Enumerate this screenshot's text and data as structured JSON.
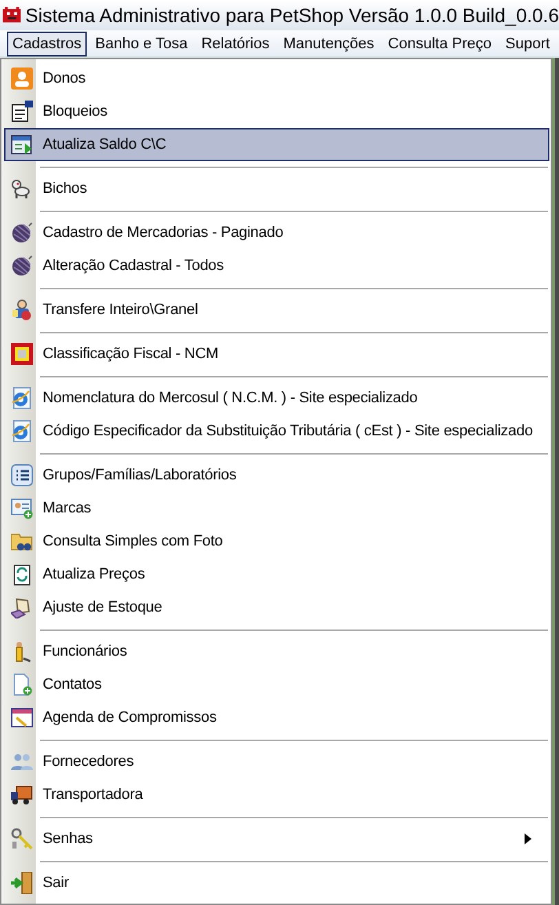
{
  "window": {
    "title": "Sistema Administrativo para PetShop Versão 1.0.0 Build_0.0.6"
  },
  "menubar": [
    {
      "label": "Cadastros",
      "selected": true
    },
    {
      "label": "Banho e Tosa",
      "selected": false
    },
    {
      "label": "Relatórios",
      "selected": false
    },
    {
      "label": "Manutenções",
      "selected": false
    },
    {
      "label": "Consulta Preço",
      "selected": false
    },
    {
      "label": "Suport",
      "selected": false
    }
  ],
  "menu": [
    {
      "kind": "item",
      "label": "Donos",
      "selected": false
    },
    {
      "kind": "item",
      "label": "Bloqueios",
      "selected": false
    },
    {
      "kind": "item",
      "label": "Atualiza Saldo C\\C",
      "selected": true
    },
    {
      "kind": "separator"
    },
    {
      "kind": "item",
      "label": "Bichos",
      "selected": false
    },
    {
      "kind": "separator"
    },
    {
      "kind": "item",
      "label": "Cadastro de Mercadorias - Paginado",
      "selected": false
    },
    {
      "kind": "item",
      "label": "Alteração Cadastral - Todos",
      "selected": false
    },
    {
      "kind": "separator"
    },
    {
      "kind": "item",
      "label": "Transfere Inteiro\\Granel",
      "selected": false
    },
    {
      "kind": "separator"
    },
    {
      "kind": "item",
      "label": "Classificação Fiscal - NCM",
      "selected": false
    },
    {
      "kind": "separator"
    },
    {
      "kind": "item",
      "label": "Nomenclatura do Mercosul ( N.C.M. ) - Site especializado",
      "selected": false
    },
    {
      "kind": "item",
      "label": "Código Especificador da Substituição Tributária ( cEst ) - Site especializado",
      "selected": false
    },
    {
      "kind": "separator"
    },
    {
      "kind": "item",
      "label": "Grupos/Famílias/Laboratórios",
      "selected": false
    },
    {
      "kind": "item",
      "label": "Marcas",
      "selected": false
    },
    {
      "kind": "item",
      "label": "Consulta Simples com Foto",
      "selected": false
    },
    {
      "kind": "item",
      "label": "Atualiza Preços",
      "selected": false
    },
    {
      "kind": "item",
      "label": "Ajuste de Estoque",
      "selected": false
    },
    {
      "kind": "separator"
    },
    {
      "kind": "item",
      "label": "Funcionários",
      "selected": false
    },
    {
      "kind": "item",
      "label": "Contatos",
      "selected": false
    },
    {
      "kind": "item",
      "label": "Agenda de Compromissos",
      "selected": false
    },
    {
      "kind": "separator"
    },
    {
      "kind": "item",
      "label": "Fornecedores",
      "selected": false
    },
    {
      "kind": "item",
      "label": "Transportadora",
      "selected": false
    },
    {
      "kind": "separator"
    },
    {
      "kind": "submenu",
      "label": "Senhas",
      "selected": false
    },
    {
      "kind": "separator"
    },
    {
      "kind": "item",
      "label": "Sair",
      "selected": false
    }
  ]
}
